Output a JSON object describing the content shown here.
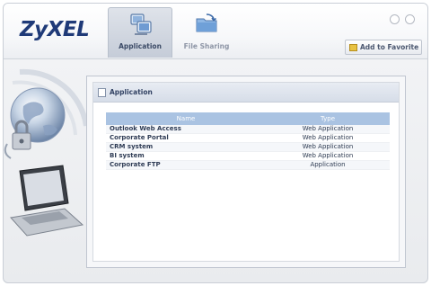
{
  "brand": {
    "logo": "ZyXEL"
  },
  "nav": {
    "tabs": [
      {
        "label": "Application",
        "icon": "application-icon",
        "active": true
      },
      {
        "label": "File Sharing",
        "icon": "file-sharing-icon",
        "active": false
      }
    ]
  },
  "toolbar": {
    "favorite_label": "Add to Favorite",
    "favorite_icon": "star-folder-icon"
  },
  "panel": {
    "title": "Application",
    "columns": [
      "Name",
      "Type"
    ],
    "rows": [
      {
        "name": "Outlook Web Access",
        "type": "Web Application"
      },
      {
        "name": "Corporate Portal",
        "type": "Web Application"
      },
      {
        "name": "CRM system",
        "type": "Web Application"
      },
      {
        "name": "BI system",
        "type": "Web Application"
      },
      {
        "name": "Corporate FTP",
        "type": "Application"
      }
    ]
  },
  "colors": {
    "brand_blue": "#1f3a78",
    "table_header": "#aac3e2"
  }
}
